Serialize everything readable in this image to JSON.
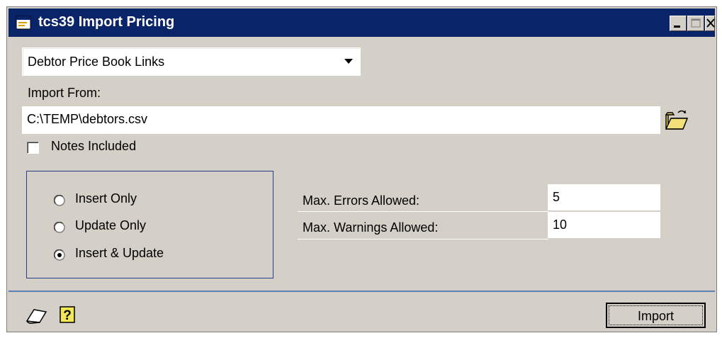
{
  "window": {
    "title": "tcs39 Import Pricing"
  },
  "combo": {
    "selected": "Debtor Price Book Links"
  },
  "import": {
    "label": "Import From:",
    "path": "C:\\TEMP\\debtors.csv"
  },
  "notes": {
    "label": "Notes Included",
    "checked": false
  },
  "modes": [
    {
      "label": "Insert Only",
      "selected": false
    },
    {
      "label": "Update Only",
      "selected": false
    },
    {
      "label": "Insert & Update",
      "selected": true
    }
  ],
  "limits": {
    "errors_label": "Max. Errors Allowed:",
    "errors_value": "5",
    "warnings_label": "Max.  Warnings Allowed:",
    "warnings_value": "10"
  },
  "buttons": {
    "import": "Import"
  },
  "colors": {
    "titlebar": "#0a246a",
    "face": "#d4d0c8",
    "divider": "#5b80b8"
  },
  "icons": [
    "app-window-icon",
    "minimize-icon",
    "maximize-icon",
    "close-icon",
    "open-folder-icon",
    "note-icon",
    "help-icon",
    "combo-dropdown-arrow-icon"
  ]
}
